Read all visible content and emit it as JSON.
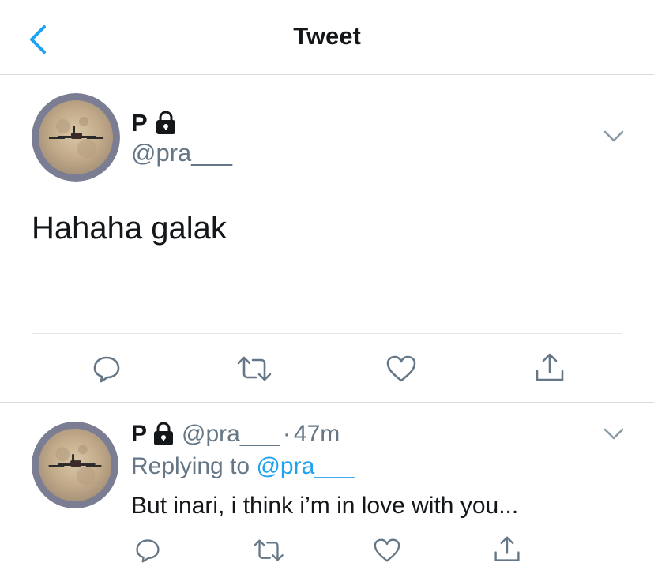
{
  "header": {
    "title": "Tweet",
    "back_icon": "chevron-left-icon"
  },
  "main_tweet": {
    "name": "P",
    "handle": "@pra___",
    "text": "Hahaha galak",
    "lock_icon": "lock-icon",
    "menu_icon": "chevron-down-icon",
    "actions": [
      "reply-icon",
      "retweet-icon",
      "like-icon",
      "share-icon"
    ]
  },
  "reply_tweet": {
    "name": "P",
    "handle": "@pra___",
    "separator": "·",
    "time": "47m",
    "replying_prefix": "Replying to",
    "replying_handle": "@pra___",
    "text": "But inari, i think i’m in love with you..."
  },
  "colors": {
    "accent": "#1da1f2",
    "secondary_text": "#657786",
    "icon_grey": "#657786",
    "avatar_ring": "#7b7d92"
  }
}
